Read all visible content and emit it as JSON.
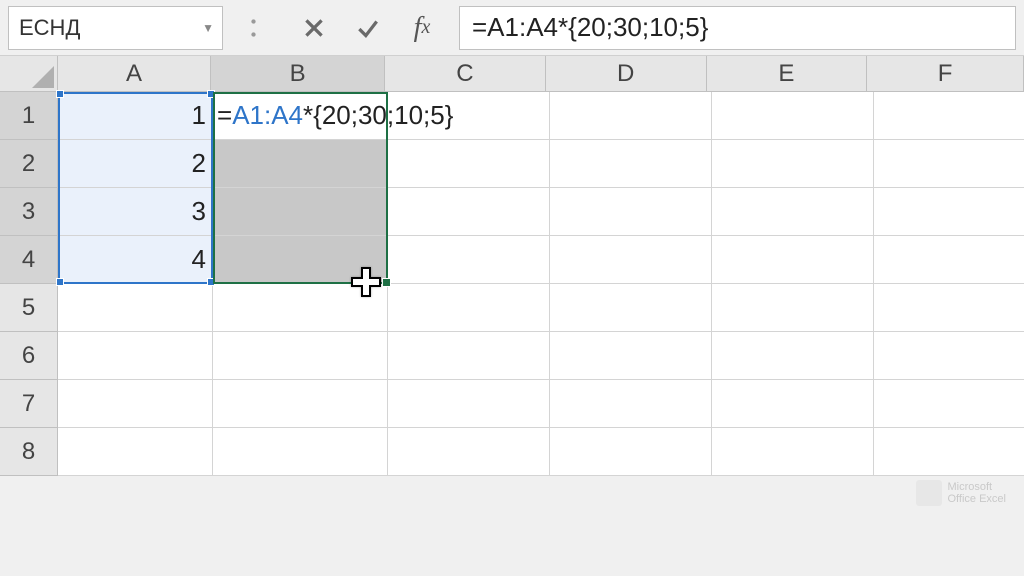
{
  "name_box": "ЕСНД",
  "formula_bar": "=A1:A4*{20;30;10;5}",
  "columns": [
    "A",
    "B",
    "C",
    "D",
    "E",
    "F"
  ],
  "rows": [
    "1",
    "2",
    "3",
    "4",
    "5",
    "6",
    "7",
    "8"
  ],
  "cells": {
    "A1": "1",
    "A2": "2",
    "A3": "3",
    "A4": "4"
  },
  "edit_cell": {
    "prefix": "=",
    "ref": "A1:A4",
    "suffix": "*{20;30;10;5}"
  },
  "watermark": {
    "line1": "Microsoft",
    "line2": "Office Excel"
  },
  "chart_data": {
    "type": "table",
    "title": "Array formula entry in Excel",
    "columns": [
      "A",
      "B"
    ],
    "data": [
      {
        "A": 1,
        "B": "=A1:A4*{20;30;10;5}"
      },
      {
        "A": 2,
        "B": ""
      },
      {
        "A": 3,
        "B": ""
      },
      {
        "A": 4,
        "B": ""
      }
    ],
    "selected_range_A": "A1:A4",
    "active_edit_range_B": "B1:B4",
    "formula": "=A1:A4*{20;30;10;5}"
  }
}
